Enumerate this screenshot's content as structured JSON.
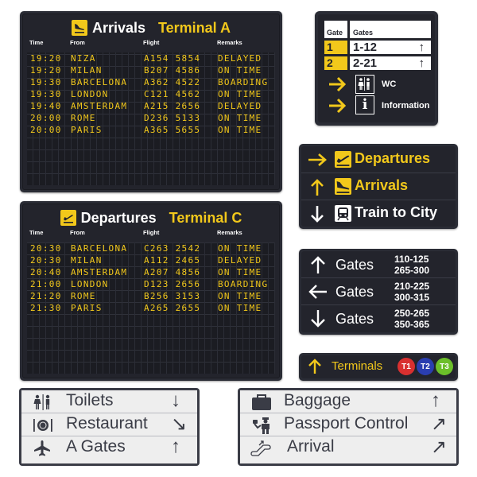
{
  "colors": {
    "board_bg": "#23242c",
    "frame": "#2a2c35",
    "yellow": "#f2c81b",
    "white": "#ffffff",
    "light_sign_bg": "#eeeeee",
    "dark_text": "#3a3c46",
    "t1": "#d93030",
    "t2": "#2a3eb0",
    "t3": "#6cbf2a"
  },
  "arrivals_board": {
    "icon": "plane-landing-icon",
    "title": "Arrivals",
    "terminal": "Terminal A",
    "columns": [
      "Time",
      "From",
      "Flight",
      "Remarks"
    ],
    "rows": [
      {
        "time": "19:20",
        "from": "NIZA",
        "flight": "A154 5854",
        "remarks": "DELAYED"
      },
      {
        "time": "19:20",
        "from": "MILAN",
        "flight": "B207 4586",
        "remarks": "ON TIME"
      },
      {
        "time": "19:30",
        "from": "BARCELONA",
        "flight": "A362 4522",
        "remarks": "BOARDING"
      },
      {
        "time": "19:30",
        "from": "LONDON",
        "flight": "C121 4562",
        "remarks": "ON TIME"
      },
      {
        "time": "19:40",
        "from": "AMSTERDAM",
        "flight": "A215 2656",
        "remarks": "DELAYED"
      },
      {
        "time": "20:00",
        "from": "ROME",
        "flight": "D236 5133",
        "remarks": "ON TIME"
      },
      {
        "time": "20:00",
        "from": "PARIS",
        "flight": "A365 5655",
        "remarks": "ON TIME"
      }
    ]
  },
  "departures_board": {
    "icon": "plane-takeoff-icon",
    "title": "Departures",
    "terminal": "Terminal C",
    "columns": [
      "Time",
      "From",
      "Flight",
      "Remarks"
    ],
    "rows": [
      {
        "time": "20:30",
        "from": "BARCELONA",
        "flight": "C263 2542",
        "remarks": "ON TIME"
      },
      {
        "time": "20:30",
        "from": "MILAN",
        "flight": "A112 2465",
        "remarks": "DELAYED"
      },
      {
        "time": "20:40",
        "from": "AMSTERDAM",
        "flight": "A207 4856",
        "remarks": "ON TIME"
      },
      {
        "time": "21:00",
        "from": "LONDON",
        "flight": "D123 2656",
        "remarks": "BOARDING"
      },
      {
        "time": "21:20",
        "from": "ROME",
        "flight": "B256 3153",
        "remarks": "ON TIME"
      },
      {
        "time": "21:30",
        "from": "PARIS",
        "flight": "A265 2655",
        "remarks": "ON TIME"
      }
    ]
  },
  "gate_sign": {
    "header_gate": "Gate",
    "header_gates": "Gates",
    "rows": [
      {
        "gate": "1",
        "range": "1-12",
        "arrow": "↑"
      },
      {
        "gate": "2",
        "range": "2-21",
        "arrow": "↑"
      }
    ],
    "wc_label": "WC",
    "info_label": "Information"
  },
  "direction_sign": {
    "rows": [
      {
        "arrow": "→",
        "icon": "plane-takeoff-icon",
        "label": "Departures",
        "color": "yellow"
      },
      {
        "arrow": "↑",
        "icon": "plane-landing-icon",
        "label": "Arrivals",
        "color": "yellow"
      },
      {
        "arrow": "↓",
        "icon": "train-icon",
        "label": "Train to City",
        "color": "white"
      }
    ]
  },
  "gates_sign": {
    "rows": [
      {
        "arrow": "↑",
        "label": "Gates",
        "ranges": [
          "110-125",
          "265-300"
        ]
      },
      {
        "arrow": "←",
        "label": "Gates",
        "ranges": [
          "210-225",
          "300-315"
        ]
      },
      {
        "arrow": "↓",
        "label": "Gates",
        "ranges": [
          "250-265",
          "350-365"
        ]
      }
    ]
  },
  "terminals_sign": {
    "arrow": "↑",
    "label": "Terminals",
    "badges": [
      "T1",
      "T2",
      "T3"
    ]
  },
  "facilities_sign": {
    "rows": [
      {
        "icon": "toilets-icon",
        "label": "Toilets",
        "arrow": "↓"
      },
      {
        "icon": "restaurant-icon",
        "label": "Restaurant",
        "arrow": "↘"
      },
      {
        "icon": "airplane-icon",
        "label": "A Gates",
        "arrow": "↑"
      }
    ]
  },
  "services_sign": {
    "rows": [
      {
        "icon": "baggage-icon",
        "label": "Baggage",
        "arrow": "↑"
      },
      {
        "icon": "passport-control-icon",
        "label": "Passport Control",
        "arrow": "↗"
      },
      {
        "icon": "escalator-icon",
        "label": "Arrival",
        "arrow": "↗"
      }
    ]
  }
}
